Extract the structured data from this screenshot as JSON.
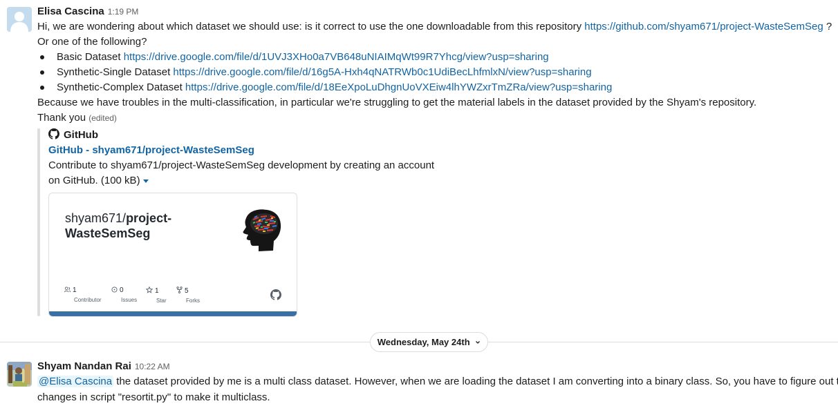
{
  "message1": {
    "sender": "Elisa Cascina",
    "time": "1:19 PM",
    "line1_text": "Hi, we are wondering about which dataset we should use: is it correct to use the one downloadable from this repository ",
    "line1_link": "https://github.com/shyam671/project-WasteSemSeg",
    "line1_tail": " ?",
    "line2": "Or one of the following?",
    "bullets": [
      {
        "label": "Basic Dataset ",
        "link": "https://drive.google.com/file/d/1UVJ3XHo0a7VB648uNIAIMqWt99R7Yhcg/view?usp=sharing"
      },
      {
        "label": "Synthetic-Single Dataset ",
        "link": "https://drive.google.com/file/d/16g5A-Hxh4qNATRWb0c1UdiBecLhfmlxN/view?usp=sharing"
      },
      {
        "label": "Synthetic-Complex Dataset ",
        "link": "https://drive.google.com/file/d/18EeXpoLuDhgnUoVXEiw4lhYWZxrTmZRa/view?usp=sharing"
      }
    ],
    "line3": "Because we have troubles in the multi-classification, in particular we're struggling to get the material labels in the dataset provided by the Shyam's repository.",
    "line4": "Thank you ",
    "edited": "(edited)",
    "unfurl": {
      "site": "GitHub",
      "title": "GitHub - shyam671/project-WasteSemSeg",
      "desc_line1": "Contribute to shyam671/project-WasteSemSeg development by creating an account",
      "desc_line2": "on GitHub. (100 kB)",
      "card": {
        "owner": "shyam671/",
        "repo_part1": "project-",
        "repo_part2": "WasteSemSeg",
        "stats": [
          {
            "value": "1",
            "label": "Contributor",
            "icon": "people-icon"
          },
          {
            "value": "0",
            "label": "Issues",
            "icon": "issue-icon"
          },
          {
            "value": "1",
            "label": "Star",
            "icon": "star-icon"
          },
          {
            "value": "5",
            "label": "Forks",
            "icon": "fork-icon"
          }
        ]
      }
    }
  },
  "date_divider": {
    "label": "Wednesday, May 24th"
  },
  "message2": {
    "sender": "Shyam Nandan Rai",
    "time": "10:22 AM",
    "mention": "@Elisa Cascina",
    "text1": " the dataset provided by me is a multi class dataset. However, when we are loading the dataset I am converting into a binary class. So, you have to figure out the",
    "text2": "changes in script \"resortit.py\" to make it multiclass."
  },
  "colors": {
    "link": "#1264a3",
    "text": "#1d1c1d",
    "muted": "#616061",
    "card_bar": "#386fa4"
  }
}
